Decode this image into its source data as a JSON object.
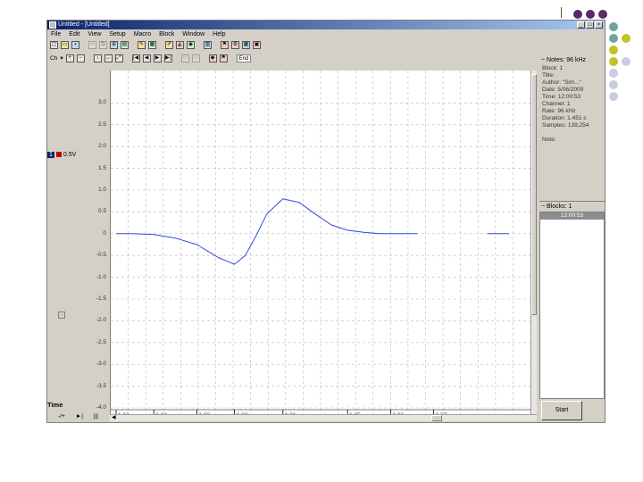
{
  "colors": {
    "accent": "#0a246a",
    "trace": "#2b4bd8",
    "grid": "#b8b8b8",
    "dot_purple": "#5a2a6a",
    "dot_teal": "#6fa3a0",
    "dot_olive": "#c2c22a",
    "dot_lavender": "#c9cde0"
  },
  "window": {
    "title": "Untitled - [Untitled]",
    "controls": [
      "_",
      "□",
      "×"
    ]
  },
  "menu": [
    "File",
    "Edit",
    "View",
    "Setup",
    "Macro",
    "Block",
    "Window",
    "Help"
  ],
  "toolbar1": {
    "icons": [
      "new-icon",
      "open-icon",
      "save-icon",
      "cut-icon",
      "copy-icon",
      "paste-icon",
      "zoom-icon",
      "rec-icon",
      "pen-icon",
      "mark-icon",
      "tool-icon",
      "chart-icon",
      "stat-icon",
      "report-icon",
      "export-icon",
      "settings-icon"
    ]
  },
  "toolbar2": {
    "channel_label": "Ch",
    "end_label": "End"
  },
  "channel": {
    "number": "1",
    "range": "0.5V"
  },
  "time_label": "Time",
  "bottom_controls": [
    "-/+",
    "►|",
    "|||"
  ],
  "right": {
    "notes_header": "Notes: 96 kHz",
    "notes": [
      "Block: 1",
      "Title:",
      "Author: \"Sim...\"",
      "Date: 5/06/2009",
      "Time: 12:00:53",
      "Channel: 1",
      "Rate: 96 kHz",
      "Duration: 1.451 s",
      "Samples: 139,254",
      "",
      "Note:"
    ],
    "blocks_header": "Blocks: 1",
    "block_item": "12:00:53",
    "start_label": "Start"
  },
  "chart_data": {
    "type": "line",
    "y_ticks": [
      "3.0",
      "2.5",
      "2.0",
      "1.5",
      "1.0",
      "0.5",
      "0",
      "-0.5",
      "-1.0",
      "-1.5",
      "-2.0",
      "-2.5",
      "-3.0",
      "-3.5",
      "-4.0"
    ],
    "x_ticks": [
      "1.12",
      "1.13",
      "1.22",
      "1.23",
      "1.31",
      "1.35",
      "1.36",
      "1.37"
    ],
    "ylim": [
      -4.0,
      3.5
    ],
    "grid": true,
    "series": [
      {
        "x": [
          1.115,
          1.13,
          1.15,
          1.17,
          1.19,
          1.21,
          1.225,
          1.235,
          1.245,
          1.255,
          1.27,
          1.285,
          1.3,
          1.315,
          1.33,
          1.345,
          1.36,
          1.375,
          1.395
        ],
        "y": [
          0.0,
          0.0,
          -0.02,
          -0.1,
          -0.25,
          -0.55,
          -0.7,
          -0.5,
          -0.05,
          0.45,
          0.8,
          0.72,
          0.45,
          0.2,
          0.08,
          0.03,
          0.0,
          0.0,
          0.0
        ]
      },
      {
        "x": [
          1.46,
          1.48
        ],
        "y": [
          0.0,
          0.0
        ]
      }
    ]
  }
}
